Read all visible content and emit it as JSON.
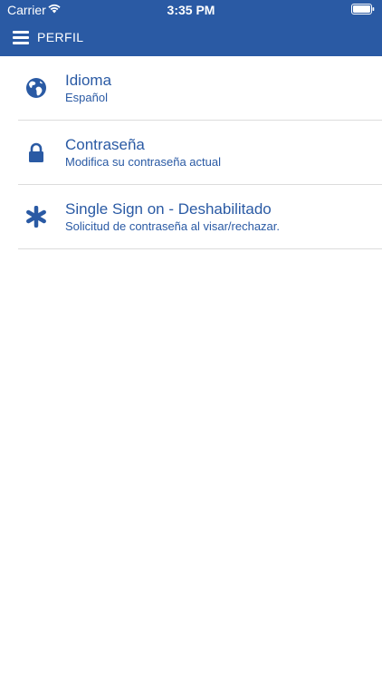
{
  "status_bar": {
    "carrier": "Carrier",
    "time": "3:35 PM"
  },
  "nav": {
    "title": "PERFIL",
    "menu_icon": "hamburger-menu-icon"
  },
  "colors": {
    "primary": "#2a5aa4",
    "divider": "#dcdcdc",
    "background": "#ffffff"
  },
  "items": [
    {
      "title": "Idioma",
      "subtitle": "Español",
      "icon": "globe-icon"
    },
    {
      "title": "Contraseña",
      "subtitle": "Modifica su contraseña actual",
      "icon": "lock-icon"
    },
    {
      "title": "Single Sign on - Deshabilitado",
      "subtitle": "Solicitud de contraseña al visar/rechazar.",
      "icon": "asterisk-icon"
    }
  ]
}
